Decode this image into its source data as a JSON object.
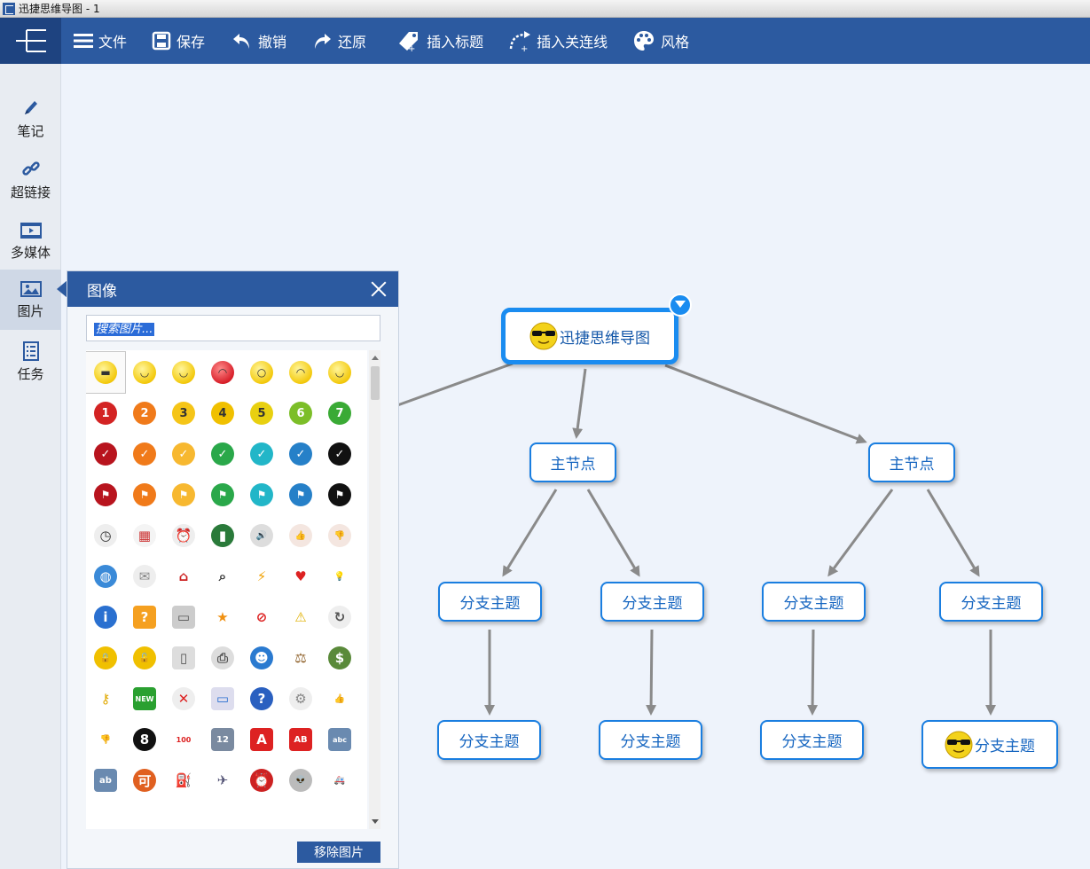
{
  "window": {
    "title": "迅捷思维导图 - 1"
  },
  "toolbar": {
    "file": "文件",
    "save": "保存",
    "undo": "撤销",
    "redo": "还原",
    "insert_label": "插入标题",
    "insert_link": "插入关连线",
    "style": "风格"
  },
  "sidebar": {
    "items": [
      {
        "label": "笔记",
        "icon": "pencil-icon"
      },
      {
        "label": "超链接",
        "icon": "link-icon"
      },
      {
        "label": "多媒体",
        "icon": "film-icon"
      },
      {
        "label": "图片",
        "icon": "image-icon"
      },
      {
        "label": "任务",
        "icon": "task-list-icon"
      }
    ],
    "active": "图片"
  },
  "mindmap": {
    "root": {
      "label": "迅捷思维导图",
      "icon": "sunglasses-smiley"
    },
    "main_nodes": [
      "主节点",
      "主节点"
    ],
    "branch_nodes": [
      "分支主题",
      "分支主题",
      "分支主题",
      "分支主题"
    ],
    "sub_nodes": [
      "分支主题",
      "分支主题",
      "分支主题",
      "分支主题"
    ],
    "sub_node_icon": "sunglasses-smiley"
  },
  "image_panel": {
    "title": "图像",
    "search_placeholder": "搜索图片...",
    "remove_button": "移除图片",
    "icons": [
      "sunglasses-face",
      "grin-face",
      "smile-face",
      "angry-face",
      "surprised-face",
      "sad-face",
      "happy-face",
      "priority-1",
      "priority-2",
      "priority-3",
      "priority-4",
      "priority-5",
      "priority-6",
      "priority-7",
      "check-red",
      "check-orange",
      "check-yellow",
      "check-green",
      "check-cyan",
      "check-blue",
      "check-black",
      "flag-red",
      "flag-orange",
      "flag-yellow",
      "flag-green",
      "flag-cyan",
      "flag-blue",
      "flag-black",
      "clock",
      "calendar",
      "alarm-clock",
      "book",
      "speaker",
      "thumb-up-light",
      "thumb-down-light",
      "globe",
      "envelope",
      "house",
      "magnifier",
      "lightning",
      "heart",
      "lightbulb",
      "info",
      "question-box",
      "briefcase",
      "star",
      "forbidden",
      "warning",
      "refresh",
      "lock",
      "unlock",
      "phone",
      "printer",
      "user",
      "gavel",
      "money-bag",
      "key",
      "new-badge",
      "close-x",
      "monitor",
      "help",
      "gear",
      "thumbs-up",
      "thumbs-down",
      "eight-ball",
      "hundred",
      "numbers-1234",
      "letter-a",
      "letters-ab",
      "abc",
      "abcd",
      "seal",
      "tower",
      "airplane",
      "alarm",
      "alien",
      "ambulance"
    ]
  }
}
